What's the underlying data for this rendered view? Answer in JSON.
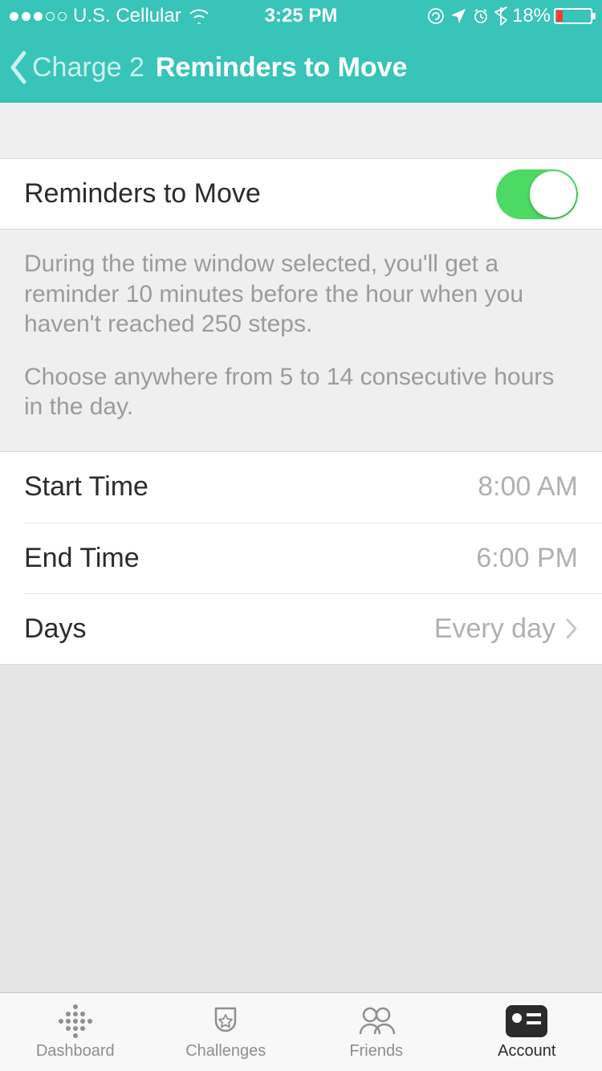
{
  "status": {
    "carrier": "U.S. Cellular",
    "time": "3:25 PM",
    "battery_pct": "18%"
  },
  "nav": {
    "back_label": "Charge 2",
    "title": "Reminders to Move"
  },
  "toggle": {
    "label": "Reminders to Move",
    "on": true
  },
  "description": {
    "p1": "During the time window selected, you'll get a reminder 10 minutes before the hour when you haven't reached 250 steps.",
    "p2": "Choose anywhere from 5 to 14 consecutive hours in the day."
  },
  "settings": {
    "start": {
      "label": "Start Time",
      "value": "8:00 AM"
    },
    "end": {
      "label": "End Time",
      "value": "6:00 PM"
    },
    "days": {
      "label": "Days",
      "value": "Every day"
    }
  },
  "tabs": {
    "dashboard": "Dashboard",
    "challenges": "Challenges",
    "friends": "Friends",
    "account": "Account"
  }
}
